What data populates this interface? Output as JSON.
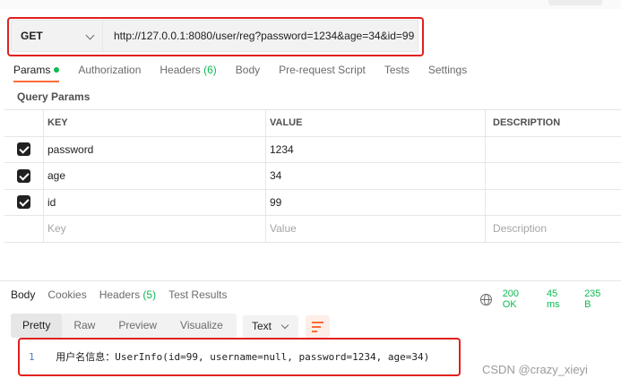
{
  "request": {
    "method": "GET",
    "url": "http://127.0.0.1:8080/user/reg?password=1234&age=34&id=99"
  },
  "tabs": [
    {
      "label": "Params",
      "has_dot": true
    },
    {
      "label": "Authorization"
    },
    {
      "label": "Headers",
      "count": "(6)"
    },
    {
      "label": "Body"
    },
    {
      "label": "Pre-request Script"
    },
    {
      "label": "Tests"
    },
    {
      "label": "Settings"
    }
  ],
  "query_params": {
    "title": "Query Params",
    "headers": [
      "KEY",
      "VALUE",
      "DESCRIPTION"
    ],
    "rows": [
      {
        "key": "password",
        "value": "1234",
        "description": "",
        "checked": true
      },
      {
        "key": "age",
        "value": "34",
        "description": "",
        "checked": true
      },
      {
        "key": "id",
        "value": "99",
        "description": "",
        "checked": true
      }
    ],
    "placeholders": {
      "key": "Key",
      "value": "Value",
      "description": "Description"
    }
  },
  "response": {
    "tabs": [
      {
        "label": "Body"
      },
      {
        "label": "Cookies"
      },
      {
        "label": "Headers",
        "count": "(5)"
      },
      {
        "label": "Test Results"
      }
    ],
    "status": "200 OK",
    "time": "45 ms",
    "size": "235 B",
    "view_modes": [
      "Pretty",
      "Raw",
      "Preview",
      "Visualize"
    ],
    "format": "Text",
    "body_lines": [
      {
        "num": "1",
        "text": "用户名信息：UserInfo(id=99, username=null, password=1234, age=34)"
      }
    ]
  },
  "watermark": "CSDN @crazy_xieyi",
  "colors": {
    "accent": "#ff6c37",
    "success": "#0cbb52",
    "highlight_box": "#e02020"
  }
}
